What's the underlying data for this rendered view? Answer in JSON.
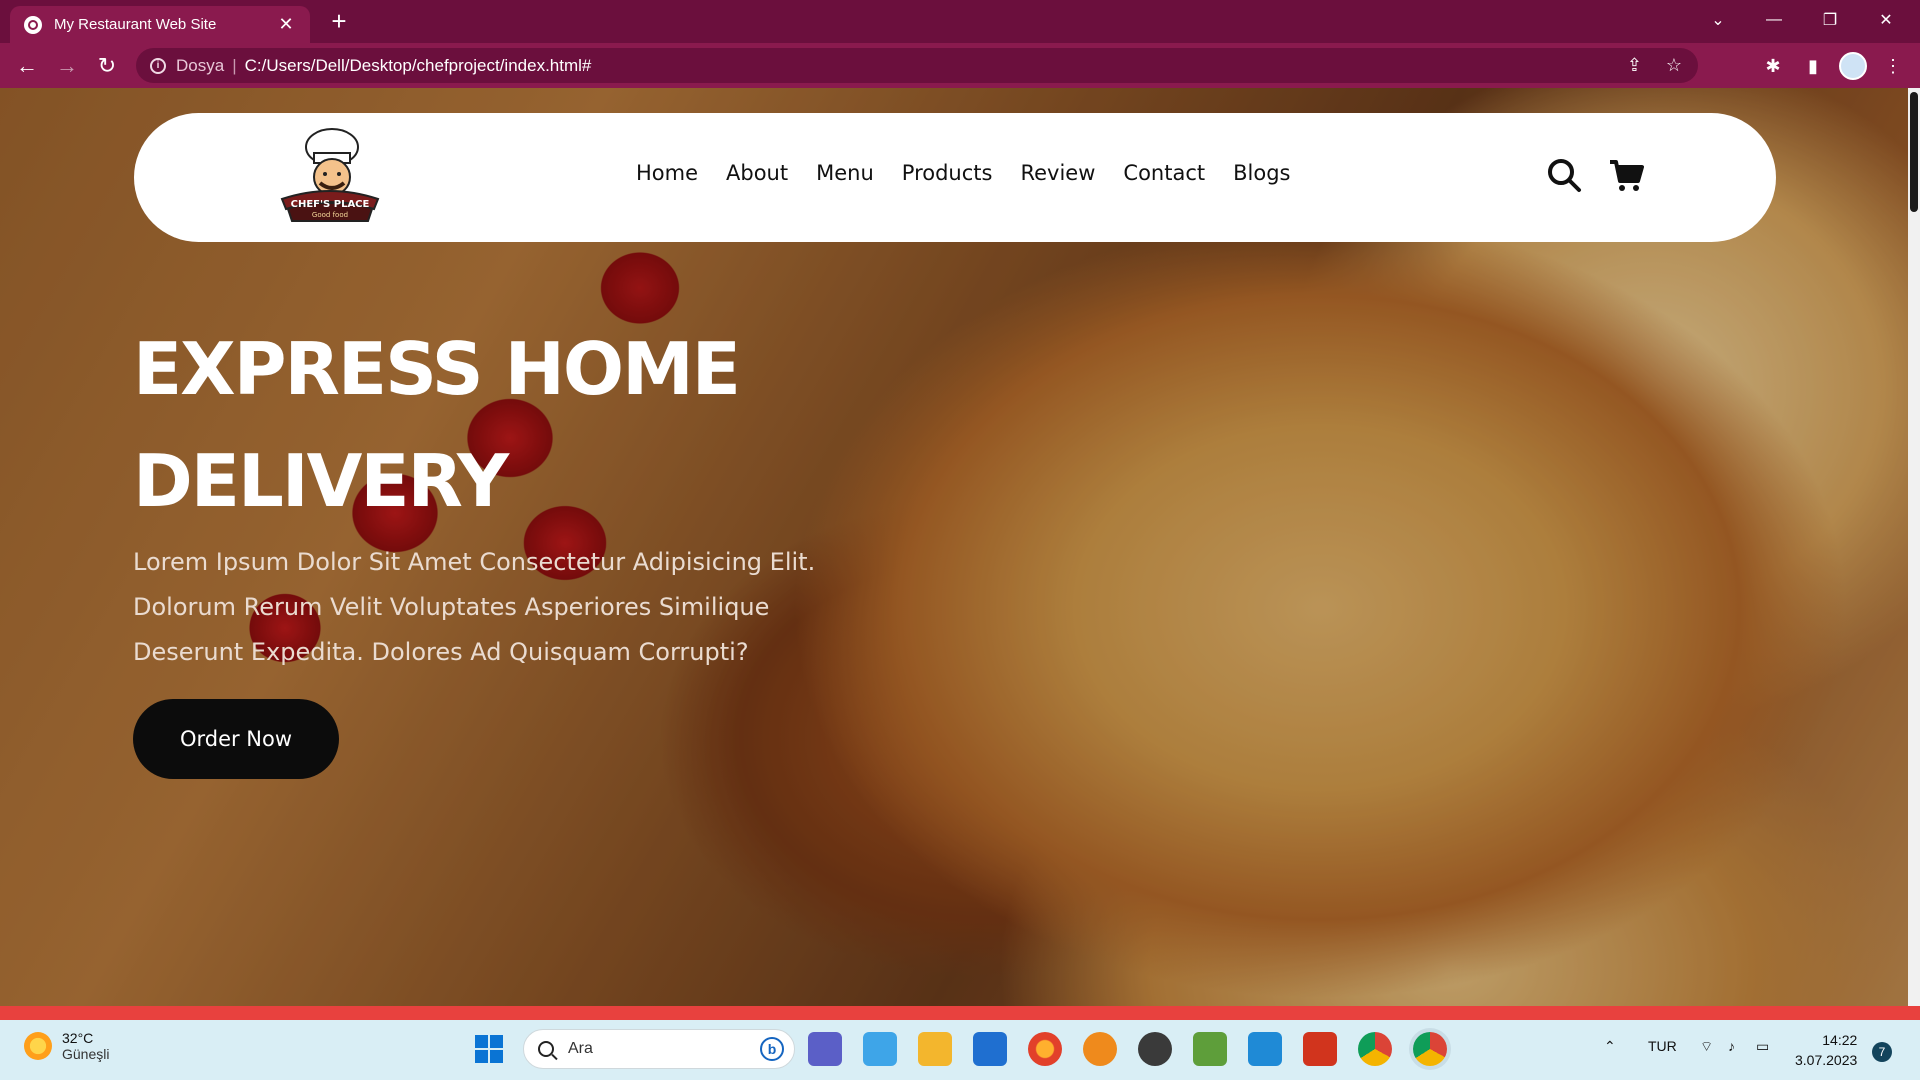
{
  "browser": {
    "tab_title": "My Restaurant Web Site",
    "new_tab": "+",
    "address_scheme": "Dosya",
    "address_url": "C:/Users/Dell/Desktop/chefproject/index.html#"
  },
  "site": {
    "logo_text": "CHEF'S PLACE",
    "logo_subtext": "Good food",
    "nav": [
      "Home",
      "About",
      "Menu",
      "Products",
      "Review",
      "Contact",
      "Blogs"
    ],
    "hero_title": "EXPRESS HOME DELIVERY",
    "hero_text": "Lorem Ipsum Dolor Sit Amet Consectetur Adipisicing Elit. Dolorum Rerum Velit Voluptates Asperiores Similique Deserunt Expedita. Dolores Ad Quisquam Corrupti?",
    "order_button": "Order Now"
  },
  "taskbar": {
    "weather_temp": "32°C",
    "weather_desc": "Güneşli",
    "search_placeholder": "Ara",
    "language": "TUR",
    "time": "14:22",
    "date": "3.07.2023",
    "notifications": "7"
  },
  "colors": {
    "browser_frame": "#6b0f3d",
    "browser_toolbar": "#8a1a4e",
    "accent_strip": "#e8413e",
    "button_bg": "#0c0c0c"
  }
}
